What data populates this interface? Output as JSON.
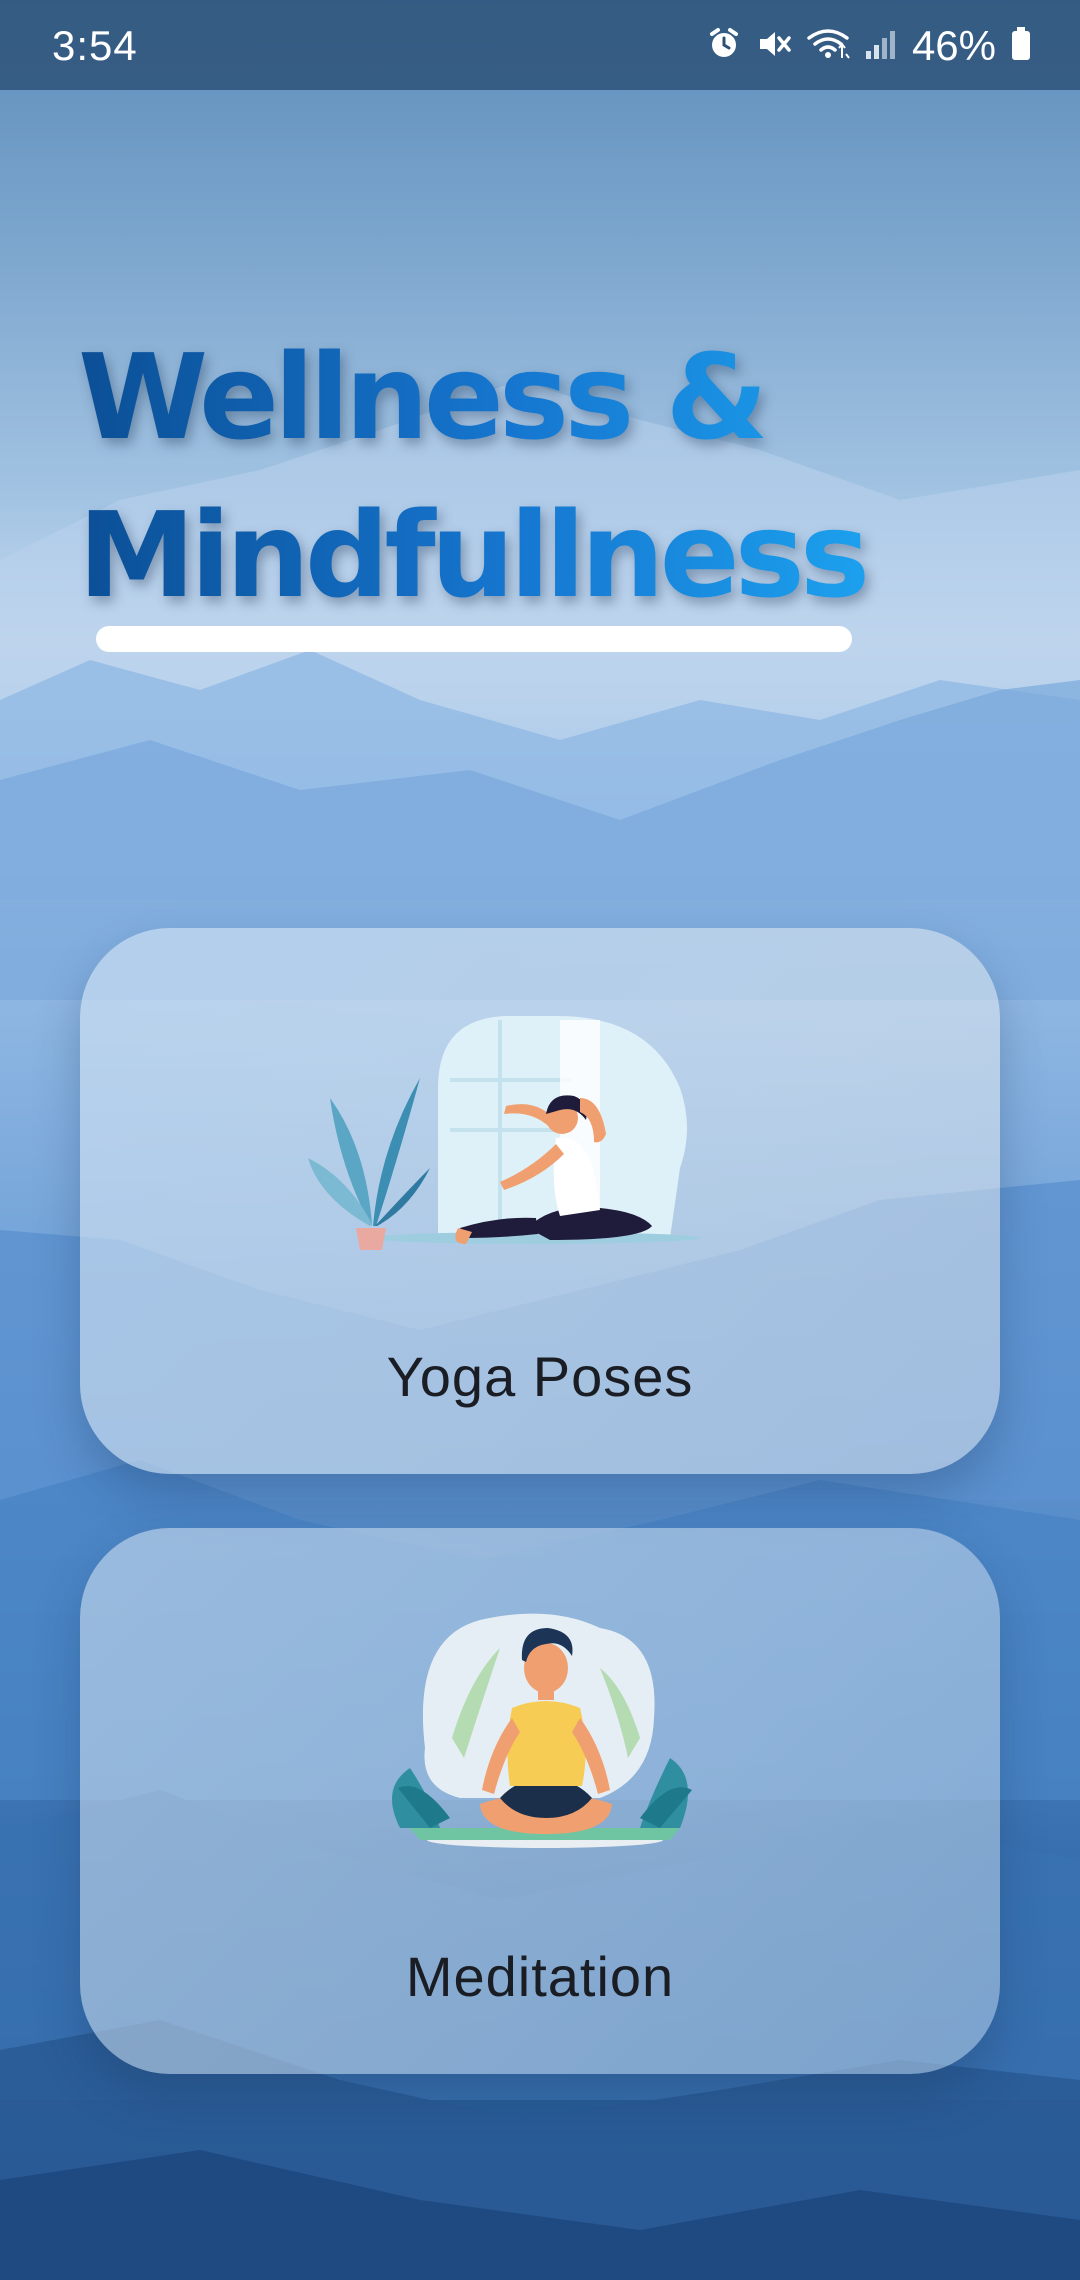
{
  "status_bar": {
    "time": "3:54",
    "icons": [
      "alarm-icon",
      "mute-icon",
      "wifi-icon",
      "signal-icon",
      "battery-icon"
    ],
    "battery": "46%"
  },
  "header": {
    "title_line1": "Wellness &",
    "title_line2": "Mindfullness"
  },
  "cards": [
    {
      "label": "Yoga Poses",
      "icon": "yoga-pose-illustration"
    },
    {
      "label": "Meditation",
      "icon": "meditation-illustration"
    }
  ],
  "colors": {
    "title_gradient_start": "#0b4f96",
    "title_gradient_end": "#1ca0ee",
    "background_top": "#5c8dbb",
    "background_bottom": "#1f4f86"
  }
}
